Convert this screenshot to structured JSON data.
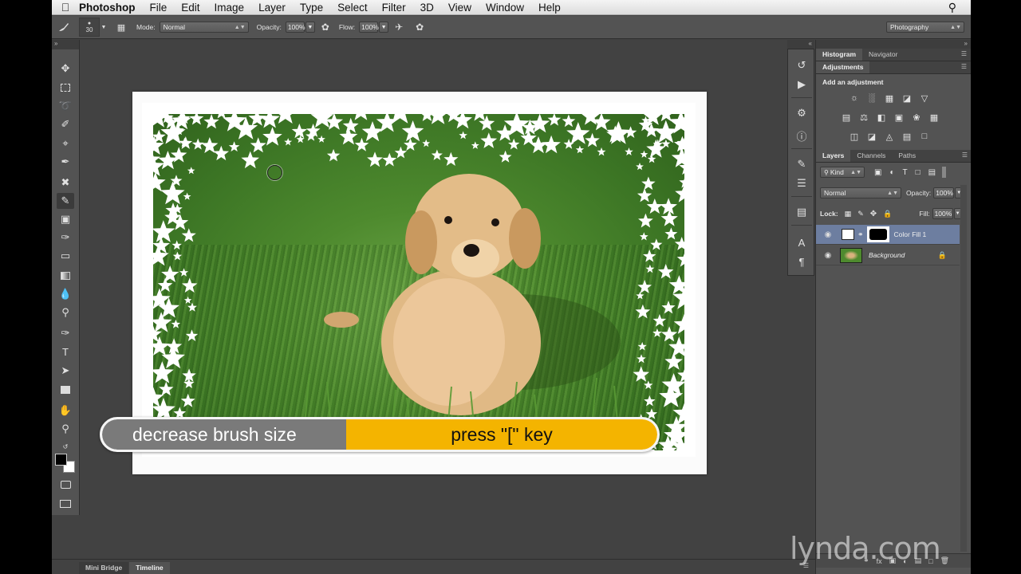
{
  "menubar": {
    "app_name": "Photoshop",
    "items": [
      "File",
      "Edit",
      "Image",
      "Layer",
      "Type",
      "Select",
      "Filter",
      "3D",
      "View",
      "Window",
      "Help"
    ]
  },
  "options_bar": {
    "brush_size": "30",
    "mode_label": "Mode:",
    "mode_value": "Normal",
    "opacity_label": "Opacity:",
    "opacity_value": "100%",
    "flow_label": "Flow:",
    "flow_value": "100%",
    "workspace": "Photography"
  },
  "caption": {
    "action": "decrease brush size",
    "shortcut": "press \"[\" key"
  },
  "panels": {
    "top_tabs": [
      "Histogram",
      "Navigator"
    ],
    "adjustments_tab": "Adjustments",
    "add_adjustment": "Add an adjustment",
    "layers_tabs": [
      "Layers",
      "Channels",
      "Paths"
    ],
    "kind_filter": "Kind",
    "blend_mode": "Normal",
    "opacity_label": "Opacity:",
    "opacity_value": "100%",
    "lock_label": "Lock:",
    "fill_label": "Fill:",
    "fill_value": "100%",
    "layers": [
      {
        "name": "Color Fill 1",
        "selected": true
      },
      {
        "name": "Background",
        "selected": false
      }
    ]
  },
  "bottom_tabs": [
    "Mini Bridge",
    "Timeline"
  ],
  "watermark": "lynda.com",
  "colors": {
    "caption_grey": "#7a7a7a",
    "caption_yellow": "#f4b400",
    "selected_layer": "#6d7ea0",
    "panel_bg": "#535353"
  }
}
